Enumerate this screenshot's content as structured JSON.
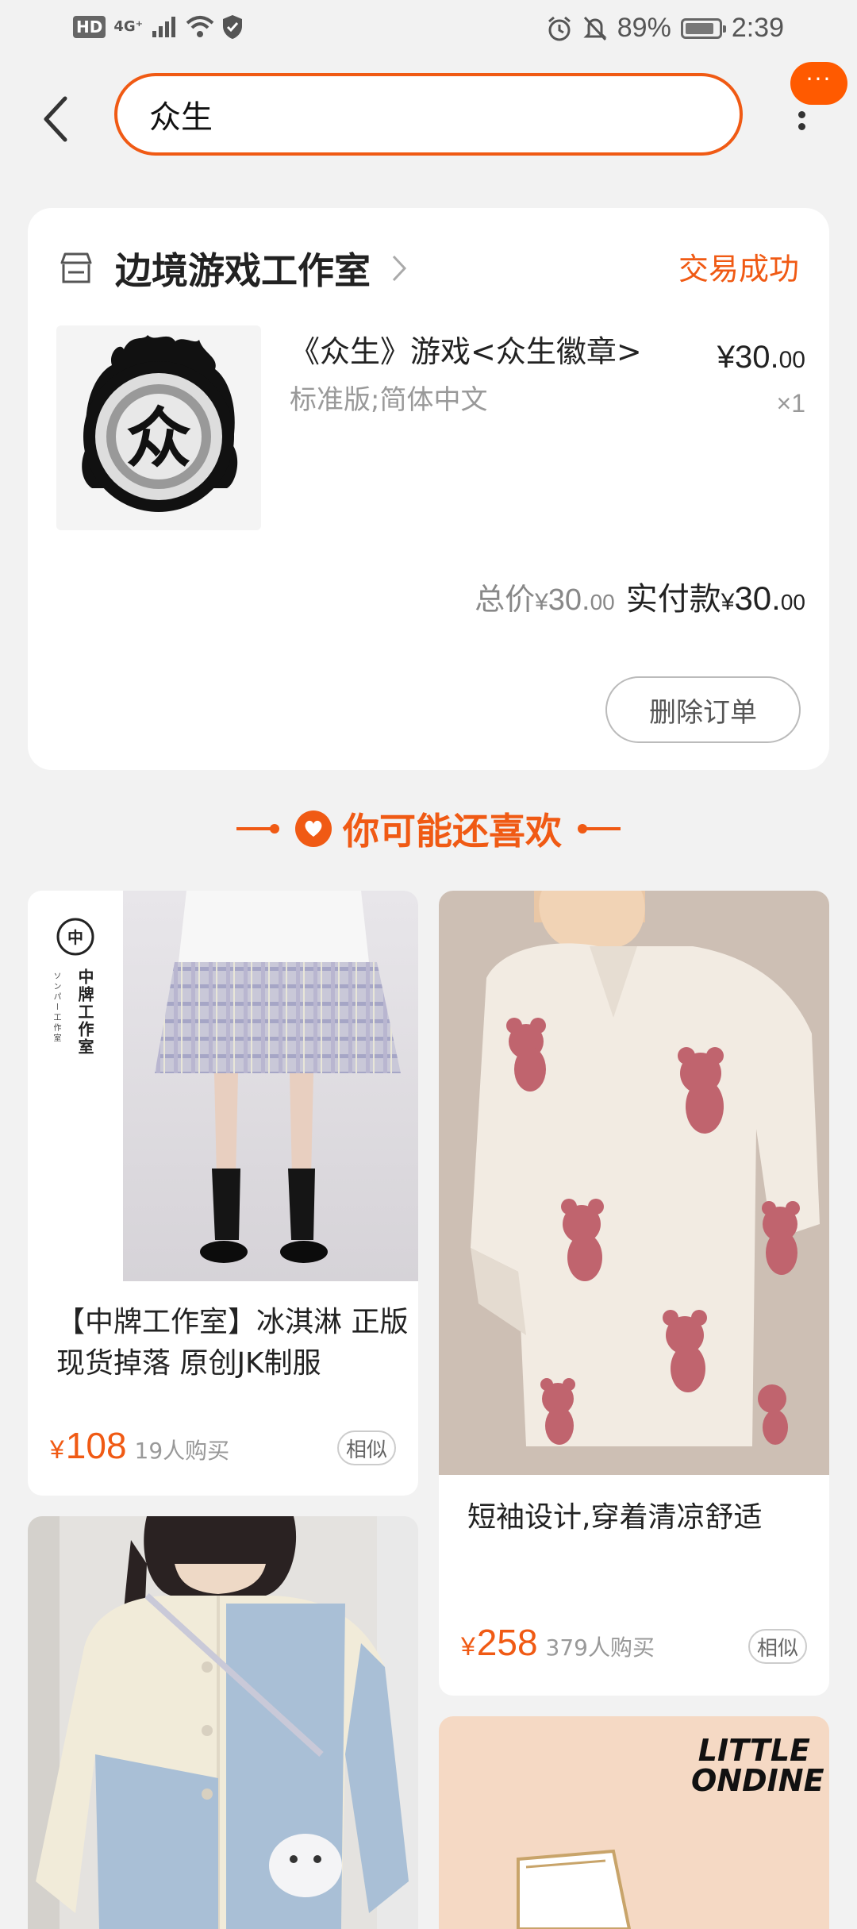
{
  "status_bar": {
    "hd": "HD",
    "network": "4G⁺",
    "battery": "89%",
    "time": "2:39",
    "battery_level": 0.89
  },
  "search": {
    "value": "众生"
  },
  "message_badge": {
    "text": "···"
  },
  "order": {
    "shop_name": "边境游戏工作室",
    "status": "交易成功",
    "product_title": "《众生》游戏<众生徽章>",
    "product_spec": "标准版;简体中文",
    "price_main": "¥30.",
    "price_decimal": "00",
    "quantity": "×1",
    "total_label": "总价",
    "total_yen": "¥",
    "total_int": "30.",
    "total_dec": "00",
    "paid_label": "实付款",
    "paid_yen": "¥",
    "paid_int": "30.",
    "paid_dec": "00",
    "delete_label": "删除订单",
    "thumb_glyph": "众"
  },
  "recommend": {
    "heading": "你可能还喜欢",
    "items": [
      {
        "title": "【中牌工作室】冰淇淋 正版 现货掉落 原创JK制服",
        "yen": "¥",
        "price": "108",
        "buyers": "19人购买",
        "similar": "相似",
        "brand_text": "中牌工作室",
        "brand_sub": "ソンパー工作室"
      },
      {
        "title": "短袖设计,穿着清凉舒适",
        "yen": "¥",
        "price": "258",
        "buyers": "379人购买",
        "similar": "相似"
      },
      {
        "title": "",
        "brand_text": "LITTLE ONDINE"
      },
      {
        "title": ""
      }
    ]
  },
  "colors": {
    "accent": "#f05a14",
    "background": "#f2f2f2"
  }
}
